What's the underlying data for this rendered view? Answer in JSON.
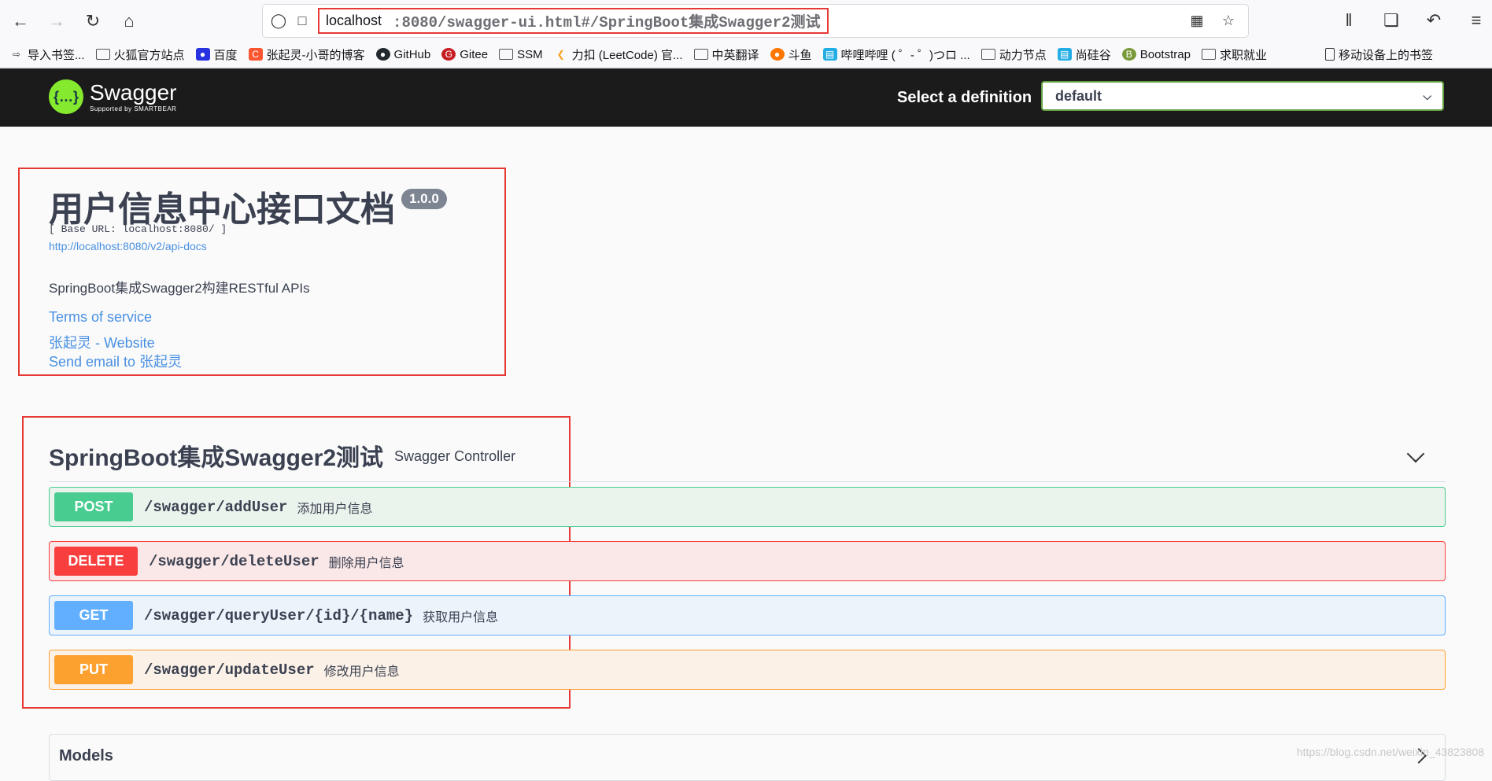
{
  "browser": {
    "url_host": "localhost",
    "url_path": ":8080/swagger-ui.html#/SpringBoot集成Swagger2测试",
    "bookmarks": [
      {
        "label": "导入书签...",
        "icon": "import-icon"
      },
      {
        "label": "火狐官方站点",
        "icon": "folder-icon"
      },
      {
        "label": "百度",
        "icon": "baidu-icon"
      },
      {
        "label": "张起灵-小哥的博客",
        "icon": "csdn-icon"
      },
      {
        "label": "GitHub",
        "icon": "github-icon"
      },
      {
        "label": "Gitee",
        "icon": "gitee-icon"
      },
      {
        "label": "SSM",
        "icon": "folder-icon"
      },
      {
        "label": "力扣 (LeetCode) 官...",
        "icon": "leetcode-icon"
      },
      {
        "label": "中英翻译",
        "icon": "folder-icon"
      },
      {
        "label": "斗鱼",
        "icon": "douyu-icon"
      },
      {
        "label": "哔哩哔哩 ( ゜- ゜)つロ ...",
        "icon": "bilibili-icon"
      },
      {
        "label": "动力节点",
        "icon": "folder-icon"
      },
      {
        "label": "尚硅谷",
        "icon": "bilibili-icon"
      },
      {
        "label": "Bootstrap",
        "icon": "bootstrap-icon"
      },
      {
        "label": "求职就业",
        "icon": "folder-icon"
      },
      {
        "label": "移动设备上的书签",
        "icon": "mobile-icon"
      }
    ]
  },
  "swagger": {
    "logo_text": "Swagger",
    "logo_sub": "Supported by SMARTBEAR",
    "select_label": "Select a definition",
    "select_value": "default"
  },
  "info": {
    "title": "用户信息中心接口文档",
    "version": "1.0.0",
    "base_url": "[ Base URL: localhost:8080/ ]",
    "api_docs_link": "http://localhost:8080/v2/api-docs",
    "description": "SpringBoot集成Swagger2构建RESTful APIs",
    "terms": "Terms of service",
    "website": "张起灵 - Website",
    "email": "Send email to 张起灵"
  },
  "tag": {
    "name": "SpringBoot集成Swagger2测试",
    "description": "Swagger Controller"
  },
  "operations": [
    {
      "method": "POST",
      "path": "/swagger/addUser",
      "summary": "添加用户信息"
    },
    {
      "method": "DELETE",
      "path": "/swagger/deleteUser",
      "summary": "删除用户信息"
    },
    {
      "method": "GET",
      "path": "/swagger/queryUser/{id}/{name}",
      "summary": "获取用户信息"
    },
    {
      "method": "PUT",
      "path": "/swagger/updateUser",
      "summary": "修改用户信息"
    }
  ],
  "models": {
    "title": "Models"
  },
  "watermark": "https://blog.csdn.net/weixin_43823808"
}
